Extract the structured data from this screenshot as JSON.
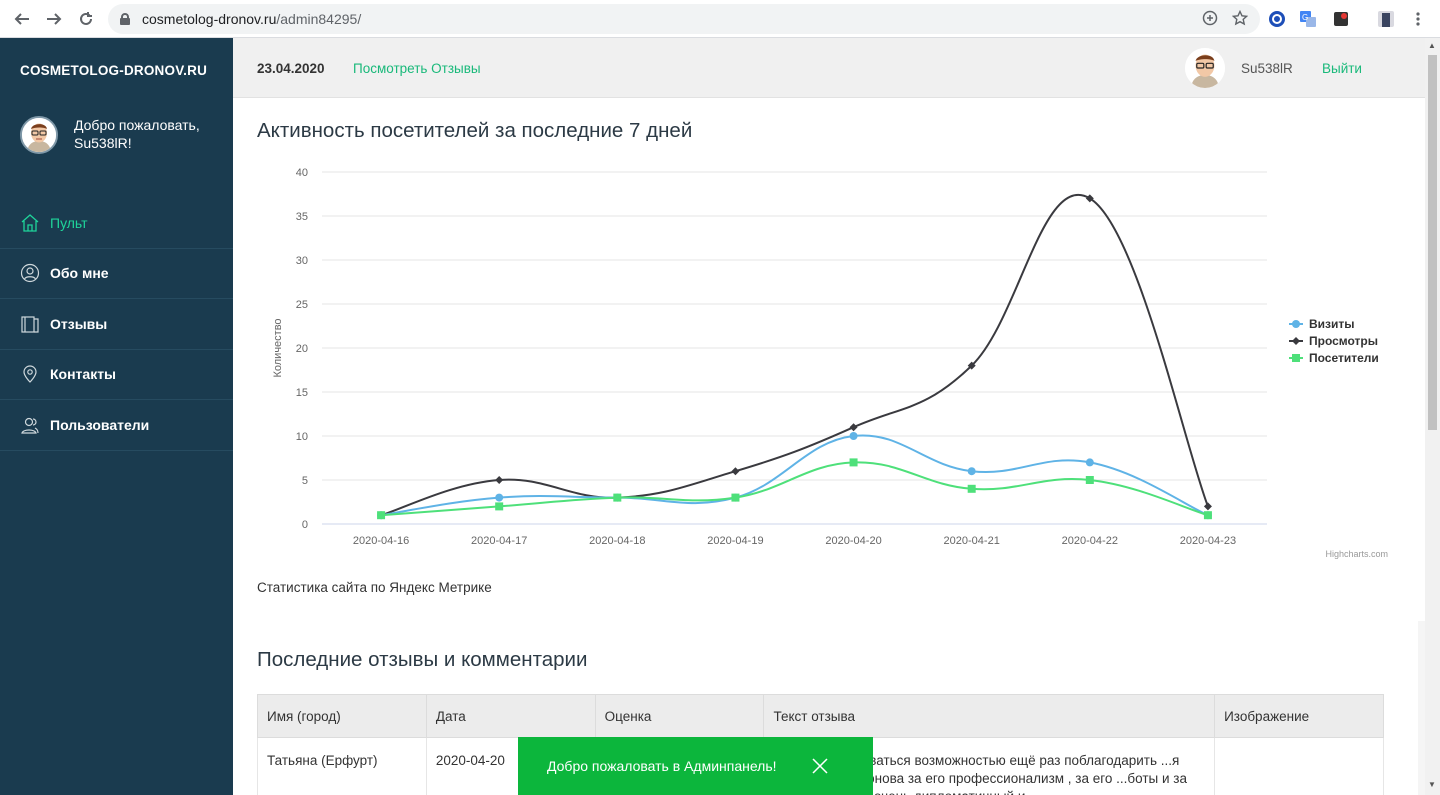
{
  "browser": {
    "url_host": "cosmetolog-dronov.ru",
    "url_path": "/admin84295/"
  },
  "sidebar": {
    "brand": "COSMETOLOG-DRONOV.RU",
    "welcome": "Добро пожаловать, Su538lR!",
    "items": [
      {
        "label": "Пульт",
        "icon": "home-icon",
        "active": true
      },
      {
        "label": "Обо мне",
        "icon": "user-icon",
        "active": false
      },
      {
        "label": "Отзывы",
        "icon": "book-icon",
        "active": false
      },
      {
        "label": "Контакты",
        "icon": "map-pin-icon",
        "active": false
      },
      {
        "label": "Пользователи",
        "icon": "users-icon",
        "active": false
      }
    ]
  },
  "header": {
    "date": "23.04.2020",
    "reviews_link": "Посмотреть Отзывы",
    "username": "Su538lR",
    "logout": "Выйти"
  },
  "main": {
    "chart_heading": "Активность посетителей за последние 7 дней",
    "chart_note": "Статистика сайта по Яндекс Метрике",
    "reviews_heading": "Последние отзывы и комментарии",
    "credits": "Highcharts.com"
  },
  "chart_data": {
    "type": "line",
    "ylabel": "Количество",
    "ylim": [
      0,
      40
    ],
    "yticks": [
      0,
      5,
      10,
      15,
      20,
      25,
      30,
      35,
      40
    ],
    "categories": [
      "2020-04-16",
      "2020-04-17",
      "2020-04-18",
      "2020-04-19",
      "2020-04-20",
      "2020-04-21",
      "2020-04-22",
      "2020-04-23"
    ],
    "legend_position": "right",
    "series": [
      {
        "name": "Визиты",
        "color": "#5fb3e6",
        "marker": "circle",
        "values": [
          1,
          3,
          3,
          3,
          10,
          6,
          7,
          1
        ]
      },
      {
        "name": "Просмотры",
        "color": "#3a3a3f",
        "marker": "diamond",
        "values": [
          1,
          5,
          3,
          6,
          11,
          18,
          37,
          2
        ]
      },
      {
        "name": "Посетители",
        "color": "#4ee07a",
        "marker": "square",
        "values": [
          1,
          2,
          3,
          3,
          7,
          4,
          5,
          1
        ]
      }
    ]
  },
  "reviews_table": {
    "headers": [
      "Имя (город)",
      "Дата",
      "Оценка",
      "Текст отзыва",
      "Изображение"
    ],
    "rows": [
      {
        "name": "Татьяна  (Ерфурт)",
        "date": "2020-04-20",
        "rating": "",
        "text": "...оваться возможностью ещё раз поблагодарить ...я Дронова за его профессионализм , за его ...боты и за его очень дипломатичный и",
        "image": ""
      }
    ]
  },
  "toast": {
    "message": "Добро пожаловать в Админпанель!"
  }
}
